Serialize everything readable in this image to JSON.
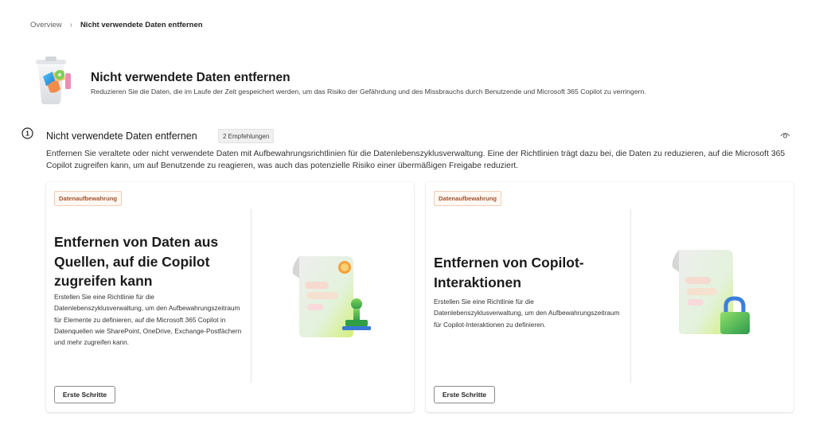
{
  "breadcrumb": {
    "overview": "Overview",
    "current": "Nicht verwendete Daten entfernen"
  },
  "hero": {
    "title": "Nicht verwendete Daten entfernen",
    "description": "Reduzieren Sie die Daten, die im Laufe der Zeit gespeichert werden, um das Risiko der Gefährdung und des Missbrauchs durch Benutzende und Microsoft 365 Copilot zu verringern.",
    "icon": "trash-bin-icon"
  },
  "section": {
    "step": "1",
    "title": "Nicht verwendete Daten entfernen",
    "badge": "2 Empfehlungen",
    "description": "Entfernen Sie veraltete oder nicht verwendete Daten mit Aufbewahrungsrichtlinien für die Datenlebenszyklusverwaltung. Eine der Richtlinien trägt dazu bei, die Daten zu reduzieren, auf die Microsoft 365 Copilot zugreifen kann, um auf Benutzende zu reagieren, was auch das potenzielle Risiko einer übermäßigen Freigabe reduziert.",
    "view_icon": "eye-icon"
  },
  "cards": [
    {
      "tag": "Datenaufbewahrung",
      "title": "Entfernen von Daten aus Quellen, auf die Copilot zugreifen kann",
      "text": "Erstellen Sie eine Richtlinie für die Datenlebenszyklusverwaltung, um den Aufbewahrungszeitraum für Elemente zu definieren, auf die Microsoft 365 Copilot in Datenquellen wie SharePoint, OneDrive, Exchange-Postfächern und mehr zugreifen kann.",
      "button": "Erste Schritte",
      "illustration": "document-stamp-icon"
    },
    {
      "tag": "Datenaufbewahrung",
      "title": "Entfernen von Copilot-Interaktionen",
      "text": "Erstellen Sie eine Richtlinie für die Datenlebenszyklusverwaltung, um den Aufbewahrungszeitraum für Copilot-Interaktionen zu definieren.",
      "button": "Erste Schritte",
      "illustration": "document-lock-icon"
    }
  ],
  "colors": {
    "tag_text": "#a0522d",
    "tag_border": "#f3cdb3",
    "button_border": "#8a8a8a"
  }
}
